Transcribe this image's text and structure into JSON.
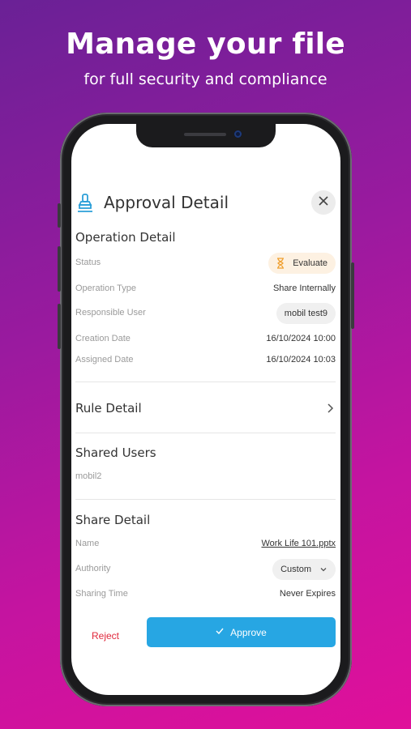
{
  "promo": {
    "headline": "Manage your file",
    "subline": "for full security and compliance"
  },
  "dialog": {
    "title": "Approval Detail",
    "title_icon": "stamp-icon",
    "close_icon": "close-icon"
  },
  "operation_detail": {
    "title": "Operation Detail",
    "status_label": "Status",
    "status_value": "Evaluate",
    "status_icon": "hourglass-icon",
    "operation_type_label": "Operation Type",
    "operation_type_value": "Share Internally",
    "responsible_user_label": "Responsible User",
    "responsible_user_value": "mobil test9",
    "creation_date_label": "Creation Date",
    "creation_date_value": "16/10/2024 10:00",
    "assigned_date_label": "Assigned Date",
    "assigned_date_value": "16/10/2024 10:03"
  },
  "rule_detail": {
    "title": "Rule Detail"
  },
  "shared_users": {
    "title": "Shared Users",
    "users": [
      "mobil2"
    ]
  },
  "share_detail": {
    "title": "Share Detail",
    "name_label": "Name",
    "name_value": "Work Life 101.pptx",
    "authority_label": "Authority",
    "authority_value": "Custom",
    "sharing_time_label": "Sharing Time",
    "sharing_time_value": "Never Expires"
  },
  "actions": {
    "reject_label": "Reject",
    "approve_label": "Approve"
  },
  "colors": {
    "accent": "#27a6e3",
    "reject": "#e0283c",
    "status_pill_bg": "#fdf1e2",
    "status_icon": "#f0a030"
  }
}
